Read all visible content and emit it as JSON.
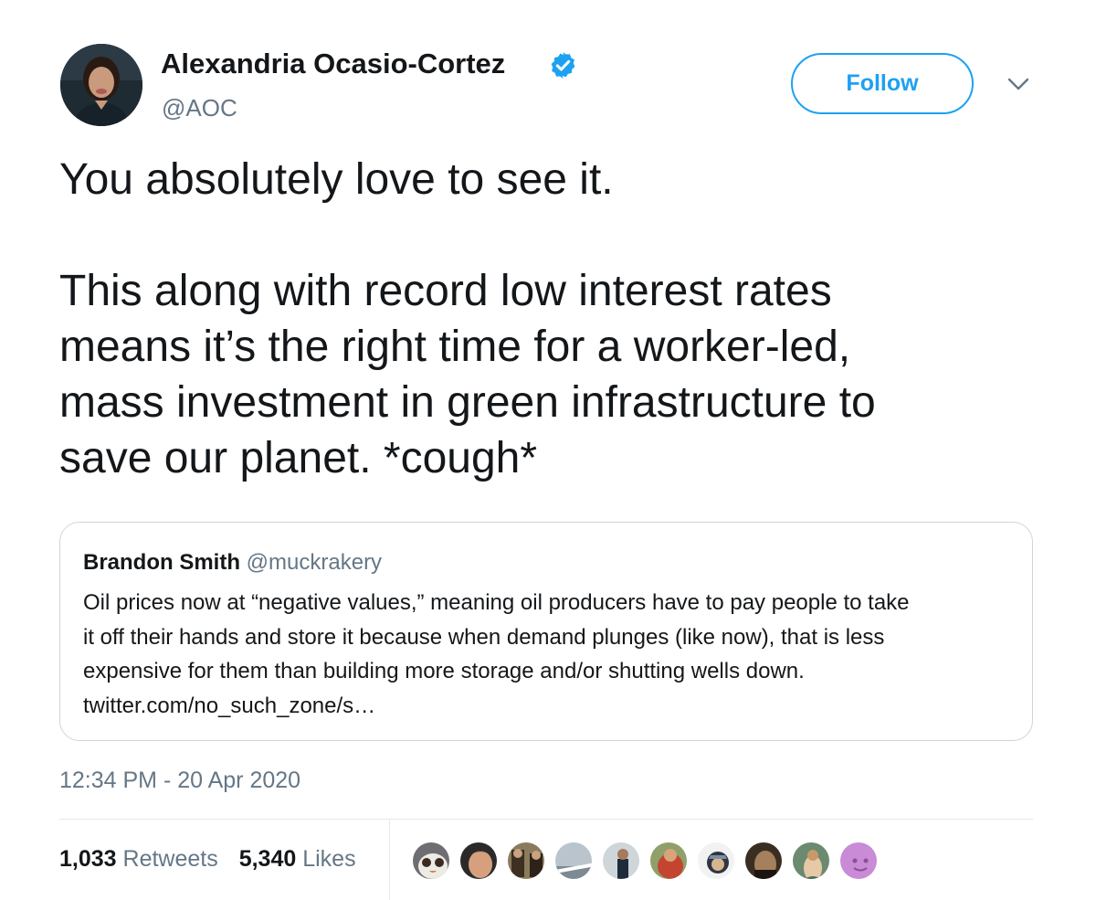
{
  "author": {
    "name": "Alexandria Ocasio-Cortez",
    "handle": "@AOC",
    "verified": true
  },
  "follow_label": "Follow",
  "tweet_text": {
    "line1": "You absolutely love to see it.",
    "para2": [
      "This along with record low interest rates",
      "means it’s the right time for a worker-led,",
      "mass investment in green infrastructure to",
      "save our planet. *cough*"
    ]
  },
  "quote": {
    "name": "Brandon Smith",
    "handle": "@muckrakery",
    "lines": [
      "Oil prices now at “negative values,” meaning oil producers have to pay people to take",
      "it off their hands and store it because when demand plunges (like now), that is less",
      "expensive for them than building more storage and/or shutting wells down.",
      "twitter.com/no_such_zone/s…"
    ]
  },
  "timestamp": "12:34 PM - 20 Apr 2020",
  "stats": {
    "retweets_count": "1,033",
    "retweets_label": "Retweets",
    "likes_count": "5,340",
    "likes_label": "Likes"
  },
  "colors": {
    "accent": "#1da1f2",
    "secondary_text": "#657786",
    "border": "#e1e8ed"
  },
  "icons": {
    "verified": "verified-badge-icon",
    "caret": "chevron-down-icon"
  }
}
